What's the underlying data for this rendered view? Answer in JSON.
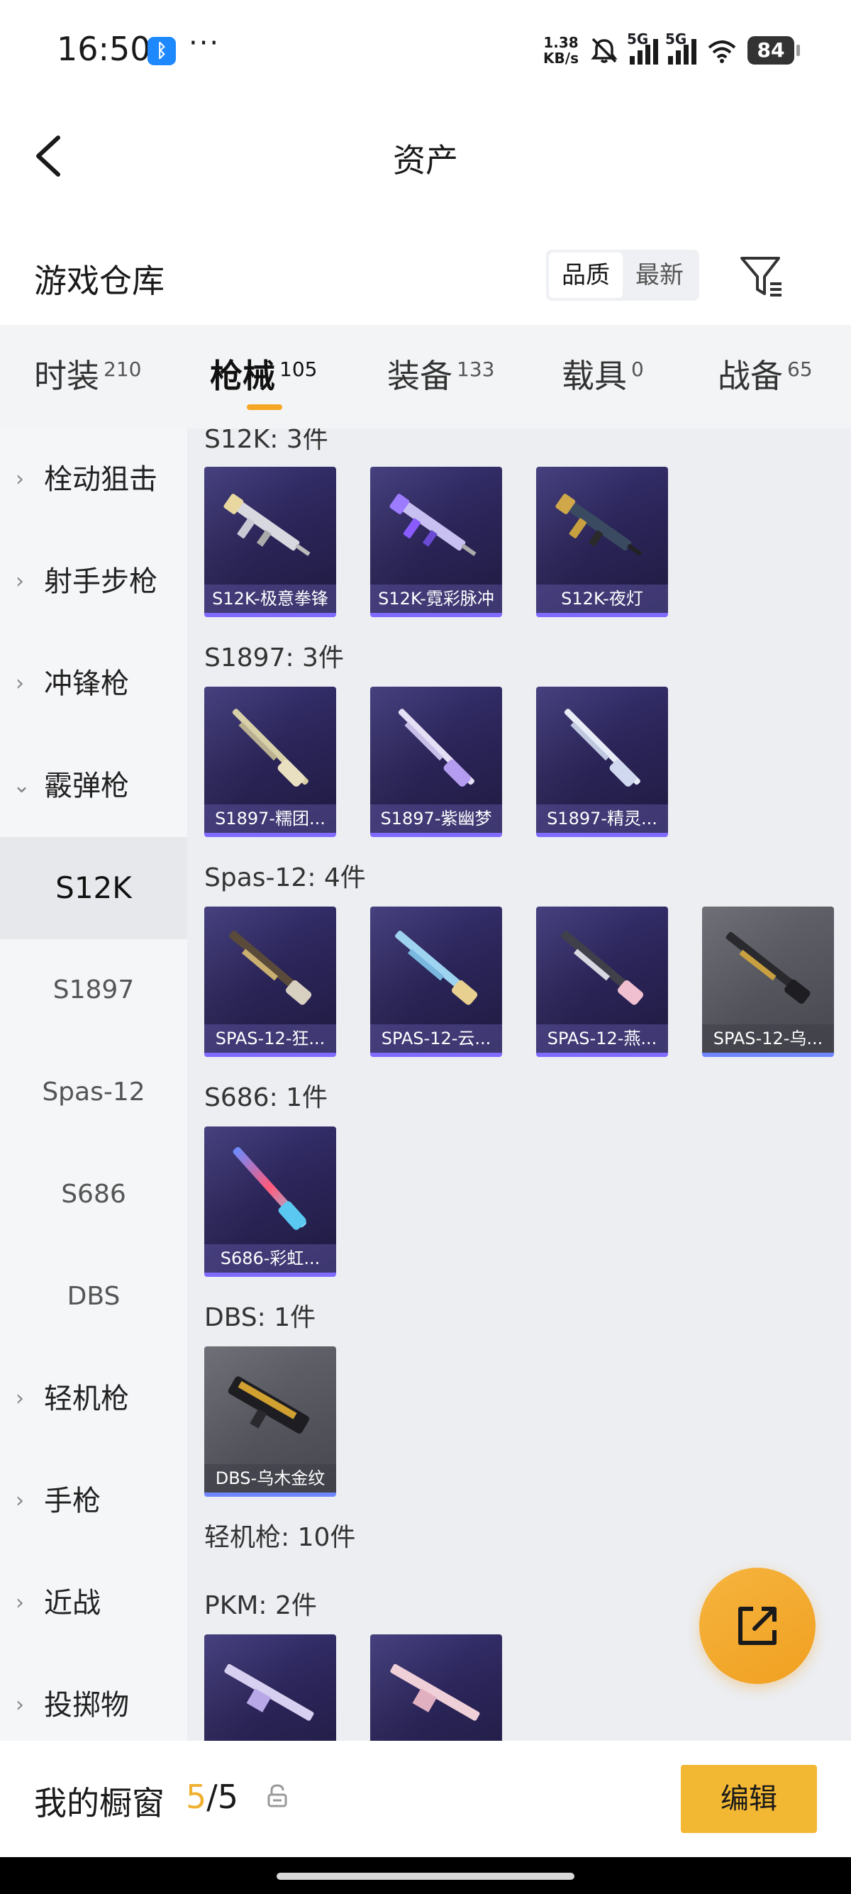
{
  "status_bar": {
    "time": "16:50",
    "bluetooth_glyph": "ᛒ",
    "more_dots": "···",
    "net_speed_value": "1.38",
    "net_speed_unit": "KB/s",
    "sim1_tag": "5G",
    "sim2_tag": "5G",
    "battery": "84"
  },
  "nav": {
    "title": "资产"
  },
  "section": {
    "title": "游戏仓库",
    "sort_options": [
      "品质",
      "最新"
    ],
    "sort_selected": "品质"
  },
  "tabs": [
    {
      "label": "时装",
      "count": "210"
    },
    {
      "label": "枪械",
      "count": "105"
    },
    {
      "label": "装备",
      "count": "133"
    },
    {
      "label": "载具",
      "count": "0"
    },
    {
      "label": "战备",
      "count": "65"
    }
  ],
  "active_tab": "枪械",
  "sidebar": {
    "categories": [
      "栓动狙击",
      "射手步枪",
      "冲锋枪",
      "霰弹枪",
      "轻机枪",
      "手枪",
      "近战",
      "投掷物"
    ],
    "expanded": "霰弹枪",
    "sub_items": [
      "S12K",
      "S1897",
      "Spas-12",
      "S686",
      "DBS"
    ],
    "active_sub": "S12K"
  },
  "groups": [
    {
      "label": "S12K: 3件",
      "items": [
        {
          "name": "S12K-极意拳锋",
          "rarity": "epic"
        },
        {
          "name": "S12K-霓彩脉冲",
          "rarity": "epic"
        },
        {
          "name": "S12K-夜灯",
          "rarity": "epic"
        }
      ]
    },
    {
      "label": "S1897: 3件",
      "items": [
        {
          "name": "S1897-糯团...",
          "rarity": "epic"
        },
        {
          "name": "S1897-紫幽梦",
          "rarity": "epic"
        },
        {
          "name": "S1897-精灵...",
          "rarity": "epic"
        }
      ]
    },
    {
      "label": "Spas-12: 4件",
      "items": [
        {
          "name": "SPAS-12-狂...",
          "rarity": "epic"
        },
        {
          "name": "SPAS-12-云...",
          "rarity": "epic"
        },
        {
          "name": "SPAS-12-燕...",
          "rarity": "epic"
        },
        {
          "name": "SPAS-12-乌...",
          "rarity": "rare"
        }
      ]
    },
    {
      "label": "S686: 1件",
      "items": [
        {
          "name": "S686-彩虹...",
          "rarity": "epic"
        }
      ]
    },
    {
      "label": "DBS: 1件",
      "items": [
        {
          "name": "DBS-乌木金纹",
          "rarity": "rare"
        }
      ]
    }
  ],
  "lmg_header": "轻机枪: 10件",
  "pkm_group": {
    "label": "PKM: 2件",
    "count_visible": 2
  },
  "bottom_bar": {
    "title": "我的橱窗",
    "current": "5",
    "separator": "/",
    "total": "5",
    "edit_label": "编辑"
  },
  "colors": {
    "accent": "#f2b733",
    "epic_card": "#2b2559",
    "rare_card": "#55565e",
    "tab_underline": "#f5a623"
  },
  "icons": [
    "back-arrow-icon",
    "filter-icon",
    "chevron-right-icon",
    "chevron-down-icon",
    "share-icon",
    "lock-icon",
    "bluetooth-icon",
    "mute-icon",
    "wifi-icon",
    "battery-icon"
  ]
}
